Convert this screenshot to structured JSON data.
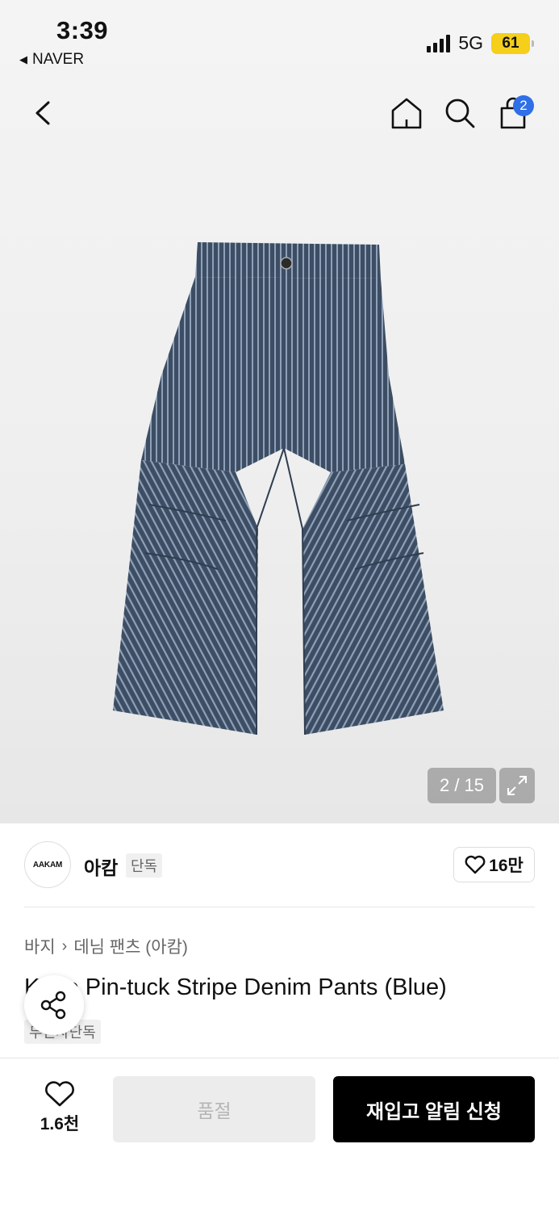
{
  "status_bar": {
    "time": "3:39",
    "back_app": "NAVER",
    "network": "5G",
    "battery": "61"
  },
  "header": {
    "cart_count": "2"
  },
  "gallery": {
    "counter": "2 / 15"
  },
  "brand": {
    "logo_text": "AAKAM",
    "name": "아캄",
    "tag": "단독",
    "likes": "16만"
  },
  "breadcrumb": {
    "items": [
      "바지",
      "데님 팬츠 (아캄)"
    ]
  },
  "product": {
    "title": "Knee Pin-tuck Stripe Denim Pants (Blue)",
    "exclusive_tag": "무신사단독"
  },
  "bottom_bar": {
    "wish_count": "1.6천",
    "soldout_label": "품절",
    "restock_label": "재입고 알림 신청"
  },
  "icons": {
    "back": "chevron-left-icon",
    "home": "home-icon",
    "search": "search-icon",
    "bag": "shopping-bag-icon",
    "expand": "expand-icon",
    "heart": "heart-icon",
    "share": "share-icon"
  }
}
